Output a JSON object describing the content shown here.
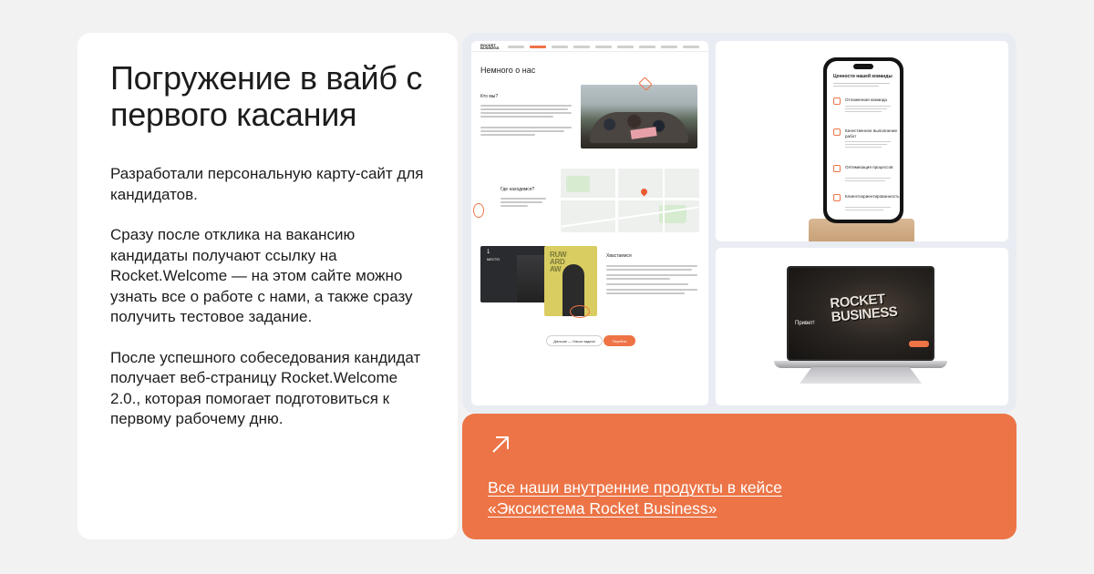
{
  "left_card": {
    "heading": "Погружение в вайб с первого касания",
    "paragraphs": [
      "Разработали персональную карту-сайт для кандидатов.",
      "Сразу после отклика на вакансию кандидаты получают ссылку на Rocket.Welcome — на этом сайте можно узнать все о работе с нами, а также сразу получить тестовое задание.",
      "После успешного собеседования кандидат получает веб-страницу Rocket.Welcome 2.0., которая помогает подготовиться к первому рабочему дню."
    ]
  },
  "site_preview": {
    "logo": "ROCKET BUSINESS",
    "title": "Немного о нас",
    "who_heading": "Кто мы?",
    "where_heading": "Где находимся?",
    "awards_heading": "Хвастаемся",
    "award_number": "1",
    "award_label": "МЕСТО",
    "award_poster_text": "RUW ARD AW",
    "button_outline": "Дальше — Наши задачи",
    "button_primary": "Перейти"
  },
  "phone_preview": {
    "title": "Ценности нашей команды",
    "values": [
      "Отлаженная команда",
      "Качественное выполнение работ",
      "Оптимизация процессов",
      "Клиентоориентированность"
    ]
  },
  "laptop_preview": {
    "brand": "ROCKET BUSINESS",
    "greeting": "Привет!"
  },
  "cta": {
    "icon": "arrow-up-right-icon",
    "link_text": "Все наши внутренние продукты в кейсе «Экосистема Rocket Business»"
  },
  "colors": {
    "accent": "#ec7446",
    "page_bg": "#f2f2f2",
    "frame_bg": "#e9edf3"
  }
}
